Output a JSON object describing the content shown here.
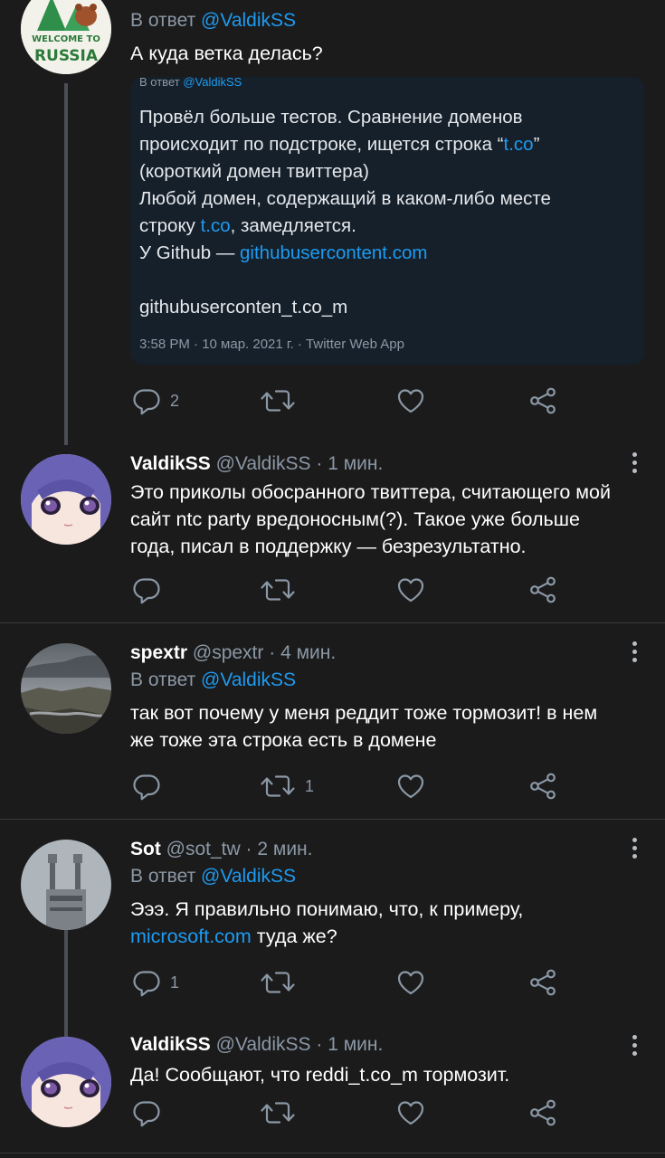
{
  "tweets": [
    {
      "reply_prefix": "В ответ",
      "reply_handle": "@ValdikSS",
      "text": "А куда ветка делась?",
      "avatar_logo_text": "WELCOME TO RUSSIA",
      "quote": {
        "reply_prefix": "В ответ",
        "reply_handle": "@ValdikSS",
        "lines": [
          "Провёл больше тестов. Сравнение доменов",
          "происходит по подстроке, ищется строка “",
          "t.co",
          "”",
          "(короткий домен твиттера)",
          "Любой домен, содержащий в каком-либо месте",
          "строку ",
          "t.co",
          ", замедляется.",
          "У Github — ",
          "githubusercontent.com",
          "githubuserconten_t.co_m"
        ],
        "meta": "3:58 PM · 10 мар. 2021 г. · Twitter Web App"
      },
      "actions": {
        "replies": "2",
        "retweets": "",
        "likes": ""
      }
    },
    {
      "name": "ValdikSS",
      "handle": "@ValdikSS",
      "time": "1 мин.",
      "lines": [
        "Это приколы обосранного твиттера, считающего мой",
        "сайт ntc party вредоносным(?). Такое уже больше",
        "года, писал в поддержку — безрезультатно."
      ],
      "actions": {
        "replies": "",
        "retweets": "",
        "likes": ""
      }
    },
    {
      "name": "spextr",
      "handle": "@spextr",
      "time": "4 мин.",
      "reply_prefix": "В ответ",
      "reply_handle": "@ValdikSS",
      "lines": [
        "так вот почему у меня реддит тоже тормозит! в нем",
        "же тоже эта строка есть в домене"
      ],
      "actions": {
        "replies": "",
        "retweets": "1",
        "likes": ""
      }
    },
    {
      "name": "Sot",
      "handle": "@sot_tw",
      "time": "2 мин.",
      "reply_prefix": "В ответ",
      "reply_handle": "@ValdikSS",
      "line1": "Эээ. Я правильно понимаю, что, к примеру,",
      "link": "microsoft.com",
      "line2_rest": " туда же?",
      "actions": {
        "replies": "1",
        "retweets": "",
        "likes": ""
      }
    },
    {
      "name": "ValdikSS",
      "handle": "@ValdikSS",
      "time": "1 мин.",
      "text": "Да! Сообщают, что reddi_t.co_m тормозит.",
      "actions": {
        "replies": "",
        "retweets": "",
        "likes": ""
      }
    }
  ],
  "separator": "·",
  "colors": {
    "background": "#1b1b1c",
    "link": "#1d9bf0",
    "muted": "#8b98a5",
    "quote_bg": "#16202b"
  }
}
